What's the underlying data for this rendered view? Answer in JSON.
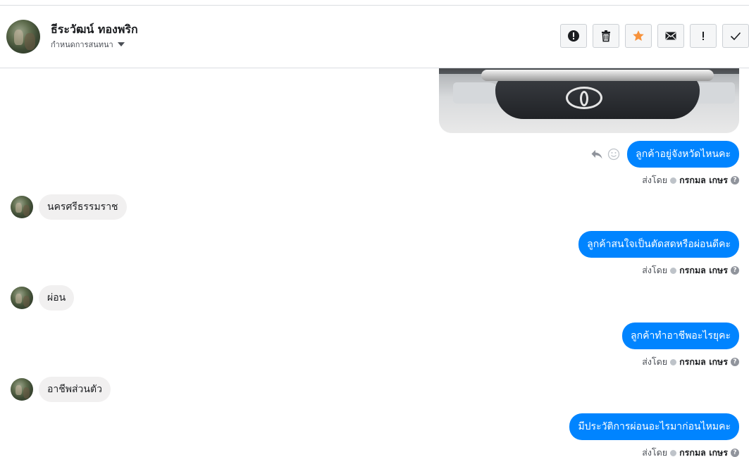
{
  "header": {
    "name": "ธีระวัฒน์ ทองพริก",
    "subtitle": "กำหนดการสนทนา"
  },
  "actions": [
    {
      "icon": "alert-circle-icon"
    },
    {
      "icon": "trash-icon"
    },
    {
      "icon": "star-icon",
      "color": "#f7923b"
    },
    {
      "icon": "mail-icon"
    },
    {
      "icon": "exclamation-icon"
    },
    {
      "icon": "check-icon"
    }
  ],
  "messages": [
    {
      "direction": "out",
      "text": "ลูกค้าอยู่จังหวัดไหนคะ",
      "sent_label": "ส่งโดย",
      "sender": "กรกมล เกษร",
      "help": "?"
    },
    {
      "direction": "in",
      "text": "นครศรีธรรมราช"
    },
    {
      "direction": "out",
      "text": "ลูกค้าสนใจเป็นตัดสดหรือผ่อนดีคะ",
      "sent_label": "ส่งโดย",
      "sender": "กรกมล เกษร",
      "help": "?"
    },
    {
      "direction": "in",
      "text": "ผ่อน"
    },
    {
      "direction": "out",
      "text": "ลูกค้าทำอาชีพอะไรยุคะ",
      "sent_label": "ส่งโดย",
      "sender": "กรกมล เกษร",
      "help": "?"
    },
    {
      "direction": "in",
      "text": "อาชีพส่วนตัว"
    },
    {
      "direction": "out",
      "text": "มีประวัติการผ่อนอะไรมาก่อนไหมคะ",
      "sent_label": "ส่งโดย",
      "sender": "กรกมล เกษร",
      "help": "?"
    }
  ],
  "colors": {
    "outgoing_bubble": "#0084ff",
    "incoming_bubble": "#f1f0f0"
  }
}
